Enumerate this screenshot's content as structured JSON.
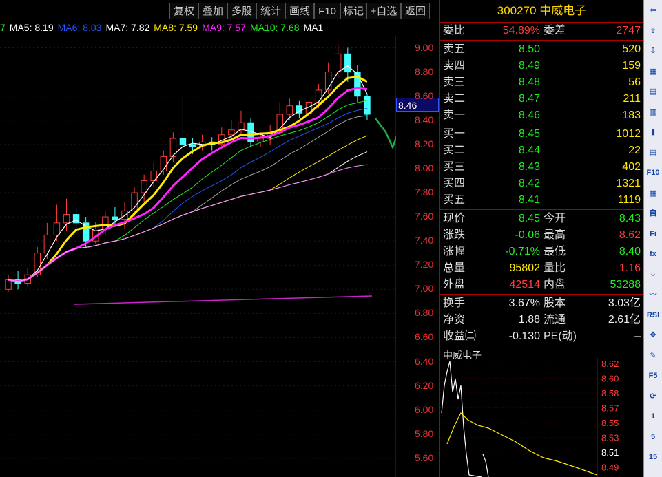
{
  "toolbar": [
    "复权",
    "叠加",
    "多股",
    "统计",
    "画线",
    "F10",
    "标记",
    "+自选",
    "返回"
  ],
  "ma_legend": [
    {
      "text": "7",
      "color": "#22ee22"
    },
    {
      "text": "MA5: 8.19",
      "color": "#ffffff"
    },
    {
      "text": "MA6: 8.03",
      "color": "#2255ff"
    },
    {
      "text": "MA7: 7.82",
      "color": "#ffffff"
    },
    {
      "text": "MA8: 7.59",
      "color": "#ffea00"
    },
    {
      "text": "MA9: 7.57",
      "color": "#ff22ff"
    },
    {
      "text": "MA10: 7.68",
      "color": "#22ee22"
    },
    {
      "text": "MA1",
      "color": "#ffffff"
    }
  ],
  "y_axis": [
    "9.00",
    "8.80",
    "8.60",
    "8.40",
    "8.20",
    "8.00",
    "7.80",
    "7.60",
    "7.40",
    "7.20",
    "7.00",
    "6.80",
    "6.60",
    "6.40",
    "6.20",
    "6.00",
    "5.80",
    "5.60"
  ],
  "current_price_tag": "8.46",
  "stock": {
    "code": "300270",
    "name": "中威电子"
  },
  "weibi": {
    "label": "委比",
    "value": "54.89%",
    "label2": "委差",
    "value2": "2747"
  },
  "asks": [
    {
      "label": "卖五",
      "price": "8.50",
      "vol": "520"
    },
    {
      "label": "卖四",
      "price": "8.49",
      "vol": "159"
    },
    {
      "label": "卖三",
      "price": "8.48",
      "vol": "56"
    },
    {
      "label": "卖二",
      "price": "8.47",
      "vol": "211"
    },
    {
      "label": "卖一",
      "price": "8.46",
      "vol": "183"
    }
  ],
  "bids": [
    {
      "label": "买一",
      "price": "8.45",
      "vol": "1012"
    },
    {
      "label": "买二",
      "price": "8.44",
      "vol": "22"
    },
    {
      "label": "买三",
      "price": "8.43",
      "vol": "402"
    },
    {
      "label": "买四",
      "price": "8.42",
      "vol": "1321"
    },
    {
      "label": "买五",
      "price": "8.41",
      "vol": "1119"
    }
  ],
  "quote": [
    {
      "l1": "现价",
      "v1": "8.45",
      "c1": "green",
      "l2": "今开",
      "v2": "8.43",
      "c2": "green"
    },
    {
      "l1": "涨跌",
      "v1": "-0.06",
      "c1": "green",
      "l2": "最高",
      "v2": "8.62",
      "c2": "red"
    },
    {
      "l1": "涨幅",
      "v1": "-0.71%",
      "c1": "green",
      "l2": "最低",
      "v2": "8.40",
      "c2": "green"
    },
    {
      "l1": "总量",
      "v1": "95802",
      "c1": "yellow",
      "l2": "量比",
      "v2": "1.16",
      "c2": "red"
    },
    {
      "l1": "外盘",
      "v1": "42514",
      "c1": "red",
      "l2": "内盘",
      "v2": "53288",
      "c2": "green"
    }
  ],
  "fundamentals": [
    {
      "l1": "换手",
      "v1": "3.67%",
      "l2": "股本",
      "v2": "3.03亿"
    },
    {
      "l1": "净资",
      "v1": "1.88",
      "l2": "流通",
      "v2": "2.61亿"
    },
    {
      "l1": "收益㈡",
      "v1": "-0.130",
      "l2": "PE(动)",
      "v2": "–"
    }
  ],
  "mini_chart": {
    "title": "中威电子",
    "y_axis": [
      "8.62",
      "8.60",
      "8.58",
      "8.57",
      "8.55",
      "8.53",
      "8.51",
      "8.49"
    ],
    "highlight": "8.51"
  },
  "right_tools": [
    "⇦",
    "⇧",
    "⇩",
    "▦",
    "▤",
    "▥",
    "▮",
    "▤",
    "F10",
    "▦",
    "自",
    "Fi",
    "fx",
    "○",
    "〰",
    "RSI",
    "✥",
    "✎",
    "F5",
    "⟳",
    "1",
    "5",
    "15"
  ],
  "chart_data": {
    "type": "candlestick",
    "ylim": [
      5.5,
      9.1
    ],
    "candles": [
      [
        7.0,
        7.08,
        6.98,
        7.12
      ],
      [
        7.08,
        7.05,
        7.0,
        7.15
      ],
      [
        7.05,
        7.12,
        7.02,
        7.18
      ],
      [
        7.12,
        7.3,
        7.1,
        7.35
      ],
      [
        7.3,
        7.45,
        7.25,
        7.55
      ],
      [
        7.45,
        7.55,
        7.4,
        7.7
      ],
      [
        7.55,
        7.62,
        7.48,
        7.75
      ],
      [
        7.62,
        7.55,
        7.5,
        7.68
      ],
      [
        7.55,
        7.4,
        7.35,
        7.6
      ],
      [
        7.4,
        7.5,
        7.38,
        7.56
      ],
      [
        7.5,
        7.6,
        7.45,
        7.65
      ],
      [
        7.6,
        7.58,
        7.52,
        7.68
      ],
      [
        7.58,
        7.65,
        7.5,
        7.72
      ],
      [
        7.65,
        7.8,
        7.6,
        7.85
      ],
      [
        7.8,
        7.9,
        7.72,
        7.95
      ],
      [
        7.9,
        7.98,
        7.85,
        8.05
      ],
      [
        7.98,
        8.1,
        7.95,
        8.15
      ],
      [
        8.1,
        8.25,
        8.05,
        8.3
      ],
      [
        8.25,
        8.2,
        8.1,
        8.6
      ],
      [
        8.2,
        8.18,
        8.12,
        8.25
      ],
      [
        8.18,
        8.22,
        8.15,
        8.28
      ],
      [
        8.22,
        8.2,
        8.15,
        8.26
      ],
      [
        8.2,
        8.28,
        8.18,
        8.34
      ],
      [
        8.28,
        8.32,
        8.24,
        8.4
      ],
      [
        8.32,
        8.38,
        8.28,
        8.48
      ],
      [
        8.38,
        8.22,
        8.18,
        8.42
      ],
      [
        8.22,
        8.25,
        8.18,
        8.3
      ],
      [
        8.25,
        8.3,
        8.2,
        8.36
      ],
      [
        8.3,
        8.45,
        8.28,
        8.55
      ],
      [
        8.45,
        8.52,
        8.4,
        8.58
      ],
      [
        8.52,
        8.46,
        8.42,
        8.56
      ],
      [
        8.46,
        8.55,
        8.44,
        8.62
      ],
      [
        8.55,
        8.65,
        8.5,
        8.7
      ],
      [
        8.65,
        8.8,
        8.62,
        8.88
      ],
      [
        8.8,
        8.95,
        8.75,
        9.03
      ],
      [
        8.95,
        8.8,
        8.72,
        9.0
      ],
      [
        8.8,
        8.6,
        8.55,
        8.86
      ],
      [
        8.6,
        8.45,
        8.4,
        8.62
      ]
    ]
  }
}
